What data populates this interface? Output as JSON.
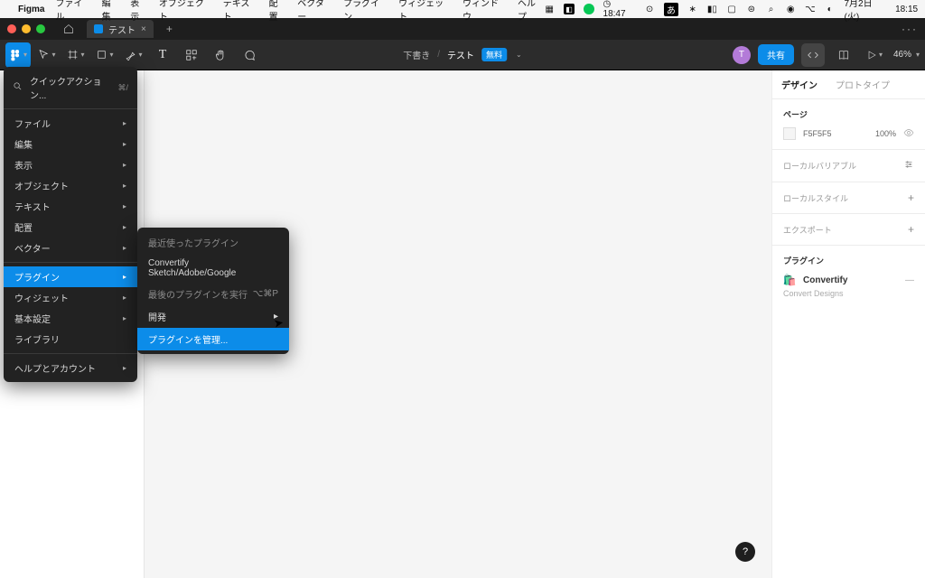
{
  "mac": {
    "app": "Figma",
    "menus": [
      "ファイル",
      "編集",
      "表示",
      "オブジェクト",
      "テキスト",
      "配置",
      "ベクター",
      "プラグイン",
      "ウィジェット",
      "ウィンドウ",
      "ヘルプ"
    ],
    "timer": "18:47",
    "lang": "あ",
    "date": "7月2日(火)",
    "clock": "18:15"
  },
  "tabs": {
    "active": "テスト",
    "close": "×",
    "add": "+",
    "more": "···"
  },
  "file": {
    "status": "下書き",
    "name": "テスト",
    "badge": "無料"
  },
  "toolbar": {
    "share": "共有",
    "zoom": "46%",
    "avatar": "T"
  },
  "menu": {
    "quick_action": "クイックアクション...",
    "quick_shortcut": "⌘/",
    "items": [
      "ファイル",
      "編集",
      "表示",
      "オブジェクト",
      "テキスト",
      "配置",
      "ベクター"
    ],
    "plugins": "プラグイン",
    "widgets": "ウィジェット",
    "basic_settings": "基本設定",
    "library": "ライブラリ",
    "help": "ヘルプとアカウント"
  },
  "submenu": {
    "recent": "最近使ったプラグイン",
    "convertify": "Convertify Sketch/Adobe/Google",
    "run_last": "最後のプラグインを実行",
    "run_last_shortcut": "⌥⌘P",
    "dev": "開発",
    "manage": "プラグインを管理..."
  },
  "right": {
    "tab_design": "デザイン",
    "tab_prototype": "プロトタイプ",
    "page": "ページ",
    "bg_hex": "F5F5F5",
    "bg_opacity": "100%",
    "local_variables": "ローカルバリアブル",
    "local_styles": "ローカルスタイル",
    "export": "エクスポート",
    "plugin_header": "プラグイン",
    "plugin_name": "Convertify",
    "plugin_desc": "Convert Designs",
    "plugin_minus": "—"
  },
  "help_fab": "?"
}
